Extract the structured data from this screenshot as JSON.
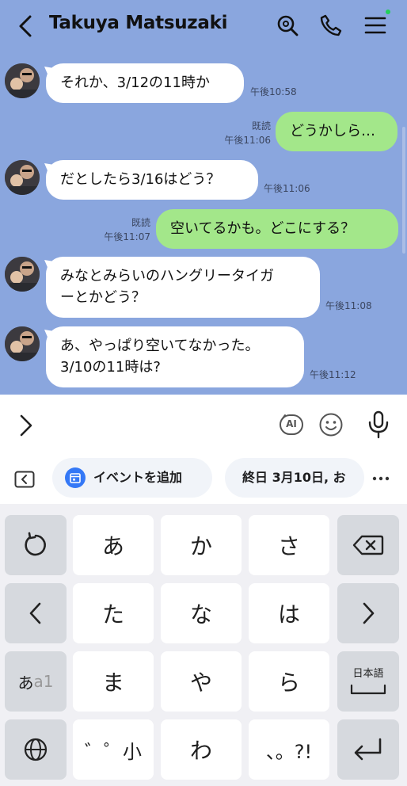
{
  "header": {
    "title": "Takuya Matsuzaki",
    "icons": [
      "back-icon",
      "search-icon",
      "phone-icon",
      "menu-icon"
    ]
  },
  "messages": [
    {
      "side": "in",
      "text": "それか、3/12の11時か",
      "time": "午後10:58"
    },
    {
      "side": "out",
      "text": "どうかしら…",
      "read": "既読",
      "time": "午後11:06"
    },
    {
      "side": "in",
      "text": "だとしたら3/16はどう？",
      "time": "午後11:06"
    },
    {
      "side": "out",
      "text": "空いてるかも。どこにする？",
      "read": "既読",
      "time": "午後11:07"
    },
    {
      "side": "in",
      "lines": [
        "みなとみらいのハングリータイガ",
        "ーとかどう？"
      ],
      "time": "午後11:08"
    },
    {
      "side": "in",
      "lines": [
        "あ、やっぱり空いてなかった。",
        "3/10の11時は?"
      ],
      "time": "午後11:12"
    }
  ],
  "input": {
    "ai_label": "AI",
    "icons": [
      "chevron-right-icon",
      "ai-icon",
      "emoji-icon",
      "mic-icon"
    ]
  },
  "suggestions": {
    "chip1": "イベントを追加",
    "chip2": "終日 3月10日, お"
  },
  "keyboard": {
    "row1": {
      "k1": "あ",
      "k2": "か",
      "k3": "さ"
    },
    "row2": {
      "k1": "た",
      "k2": "な",
      "k3": "は"
    },
    "row3": {
      "k1": "ま",
      "k2": "や",
      "k3": "ら"
    },
    "row4": {
      "k1": "゛゜小",
      "k2": "わ",
      "k3": "、。?!"
    },
    "mode_kana": "あ",
    "mode_alpha": "a1",
    "lang_label": "日本語"
  },
  "colors": {
    "chat_bg": "#8aa6de",
    "bubble_out": "#a3e78a",
    "bubble_in": "#ffffff",
    "online_dot": "#22d05a",
    "calendar_icon": "#3478f6"
  }
}
